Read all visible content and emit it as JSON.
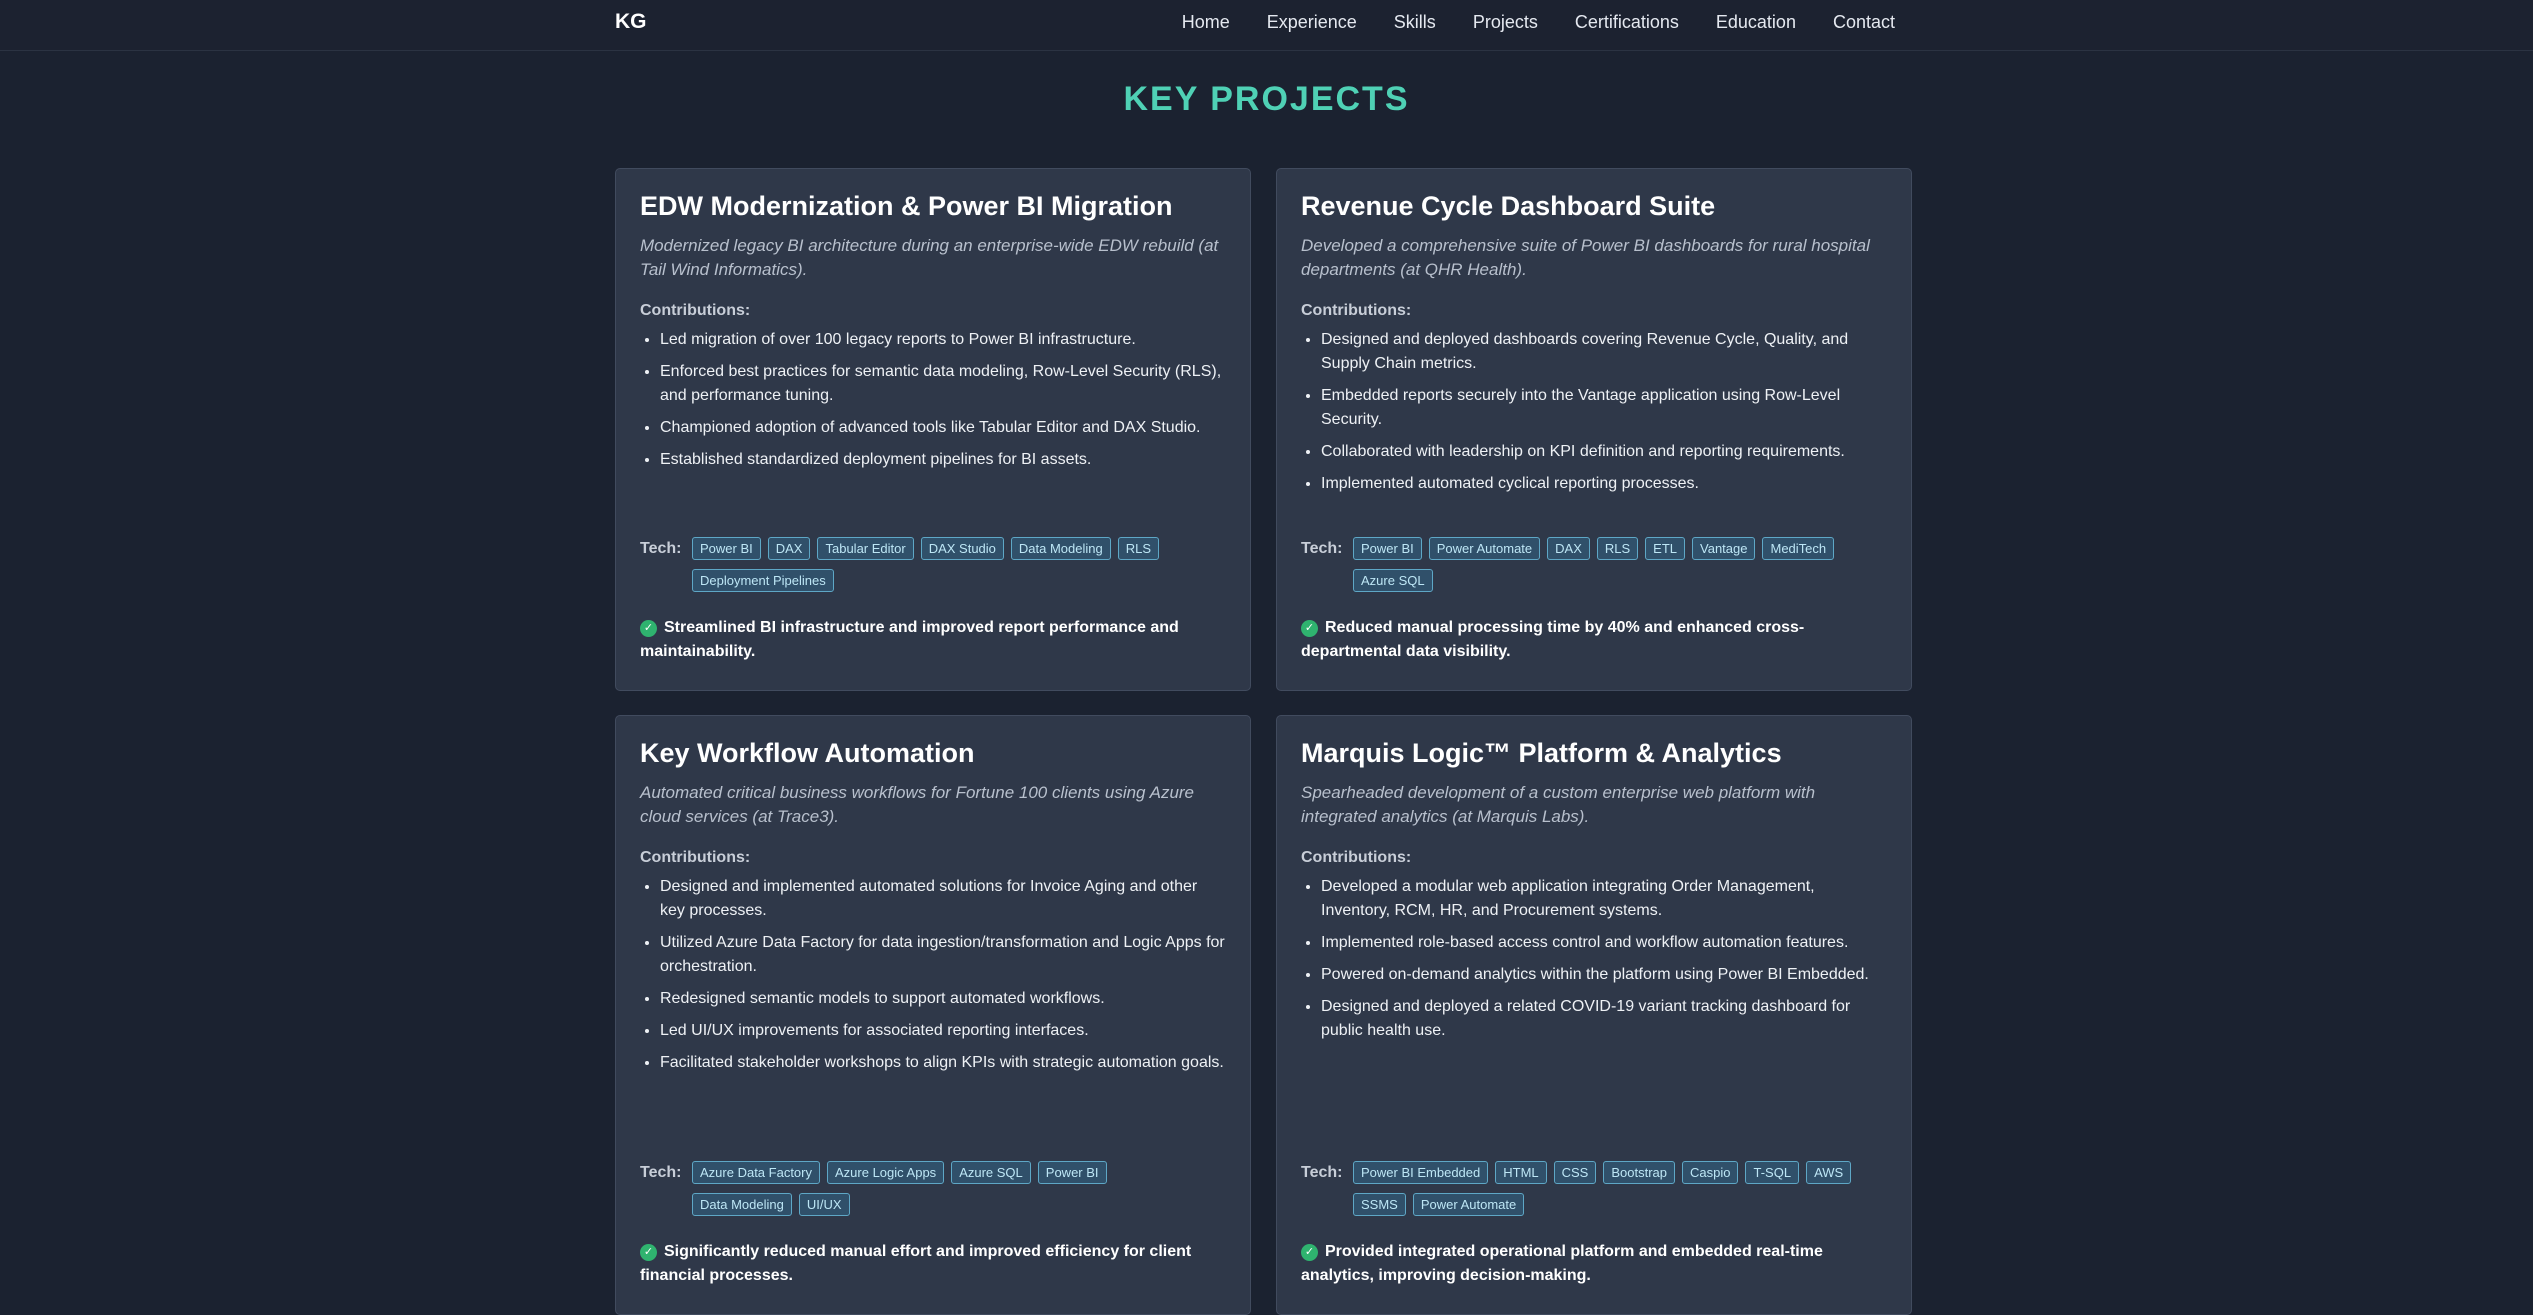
{
  "nav": {
    "brand": "KG",
    "items": [
      "Home",
      "Experience",
      "Skills",
      "Projects",
      "Certifications",
      "Education",
      "Contact"
    ]
  },
  "section": {
    "title": "KEY PROJECTS"
  },
  "labels": {
    "contributions": "Contributions:",
    "tech": "Tech:"
  },
  "colors": {
    "accent": "#4fd1b5",
    "card_bg": "#2f3849",
    "page_bg": "#1b2230",
    "tag_bg": "#30506a",
    "check": "#2fb36f"
  },
  "projects": [
    {
      "title": "EDW Modernization & Power BI Migration",
      "description": "Modernized legacy BI architecture during an enterprise-wide EDW rebuild (at Tail Wind Informatics).",
      "contributions": [
        "Led migration of over 100 legacy reports to Power BI infrastructure.",
        "Enforced best practices for semantic data modeling, Row-Level Security (RLS), and performance tuning.",
        "Championed adoption of advanced tools like Tabular Editor and DAX Studio.",
        "Established standardized deployment pipelines for BI assets."
      ],
      "tech": [
        "Power BI",
        "DAX",
        "Tabular Editor",
        "DAX Studio",
        "Data Modeling",
        "RLS",
        "Deployment Pipelines"
      ],
      "outcome": "Streamlined BI infrastructure and improved report performance and maintainability."
    },
    {
      "title": "Revenue Cycle Dashboard Suite",
      "description": "Developed a comprehensive suite of Power BI dashboards for rural hospital departments (at QHR Health).",
      "contributions": [
        "Designed and deployed dashboards covering Revenue Cycle, Quality, and Supply Chain metrics.",
        "Embedded reports securely into the Vantage application using Row-Level Security.",
        "Collaborated with leadership on KPI definition and reporting requirements.",
        "Implemented automated cyclical reporting processes."
      ],
      "tech": [
        "Power BI",
        "Power Automate",
        "DAX",
        "RLS",
        "ETL",
        "Vantage",
        "MediTech",
        "Azure SQL"
      ],
      "outcome": "Reduced manual processing time by 40% and enhanced cross-departmental data visibility."
    },
    {
      "title": "Key Workflow Automation",
      "description": "Automated critical business workflows for Fortune 100 clients using Azure cloud services (at Trace3).",
      "contributions": [
        "Designed and implemented automated solutions for Invoice Aging and other key processes.",
        "Utilized Azure Data Factory for data ingestion/transformation and Logic Apps for orchestration.",
        "Redesigned semantic models to support automated workflows.",
        "Led UI/UX improvements for associated reporting interfaces.",
        "Facilitated stakeholder workshops to align KPIs with strategic automation goals."
      ],
      "tech": [
        "Azure Data Factory",
        "Azure Logic Apps",
        "Azure SQL",
        "Power BI",
        "Data Modeling",
        "UI/UX"
      ],
      "outcome": "Significantly reduced manual effort and improved efficiency for client financial processes."
    },
    {
      "title": "Marquis Logic™ Platform & Analytics",
      "description": "Spearheaded development of a custom enterprise web platform with integrated analytics (at Marquis Labs).",
      "contributions": [
        "Developed a modular web application integrating Order Management, Inventory, RCM, HR, and Procurement systems.",
        "Implemented role-based access control and workflow automation features.",
        "Powered on-demand analytics within the platform using Power BI Embedded.",
        "Designed and deployed a related COVID-19 variant tracking dashboard for public health use."
      ],
      "tech": [
        "Power BI Embedded",
        "HTML",
        "CSS",
        "Bootstrap",
        "Caspio",
        "T-SQL",
        "AWS",
        "SSMS",
        "Power Automate"
      ],
      "outcome": "Provided integrated operational platform and embedded real-time analytics, improving decision-making."
    }
  ]
}
